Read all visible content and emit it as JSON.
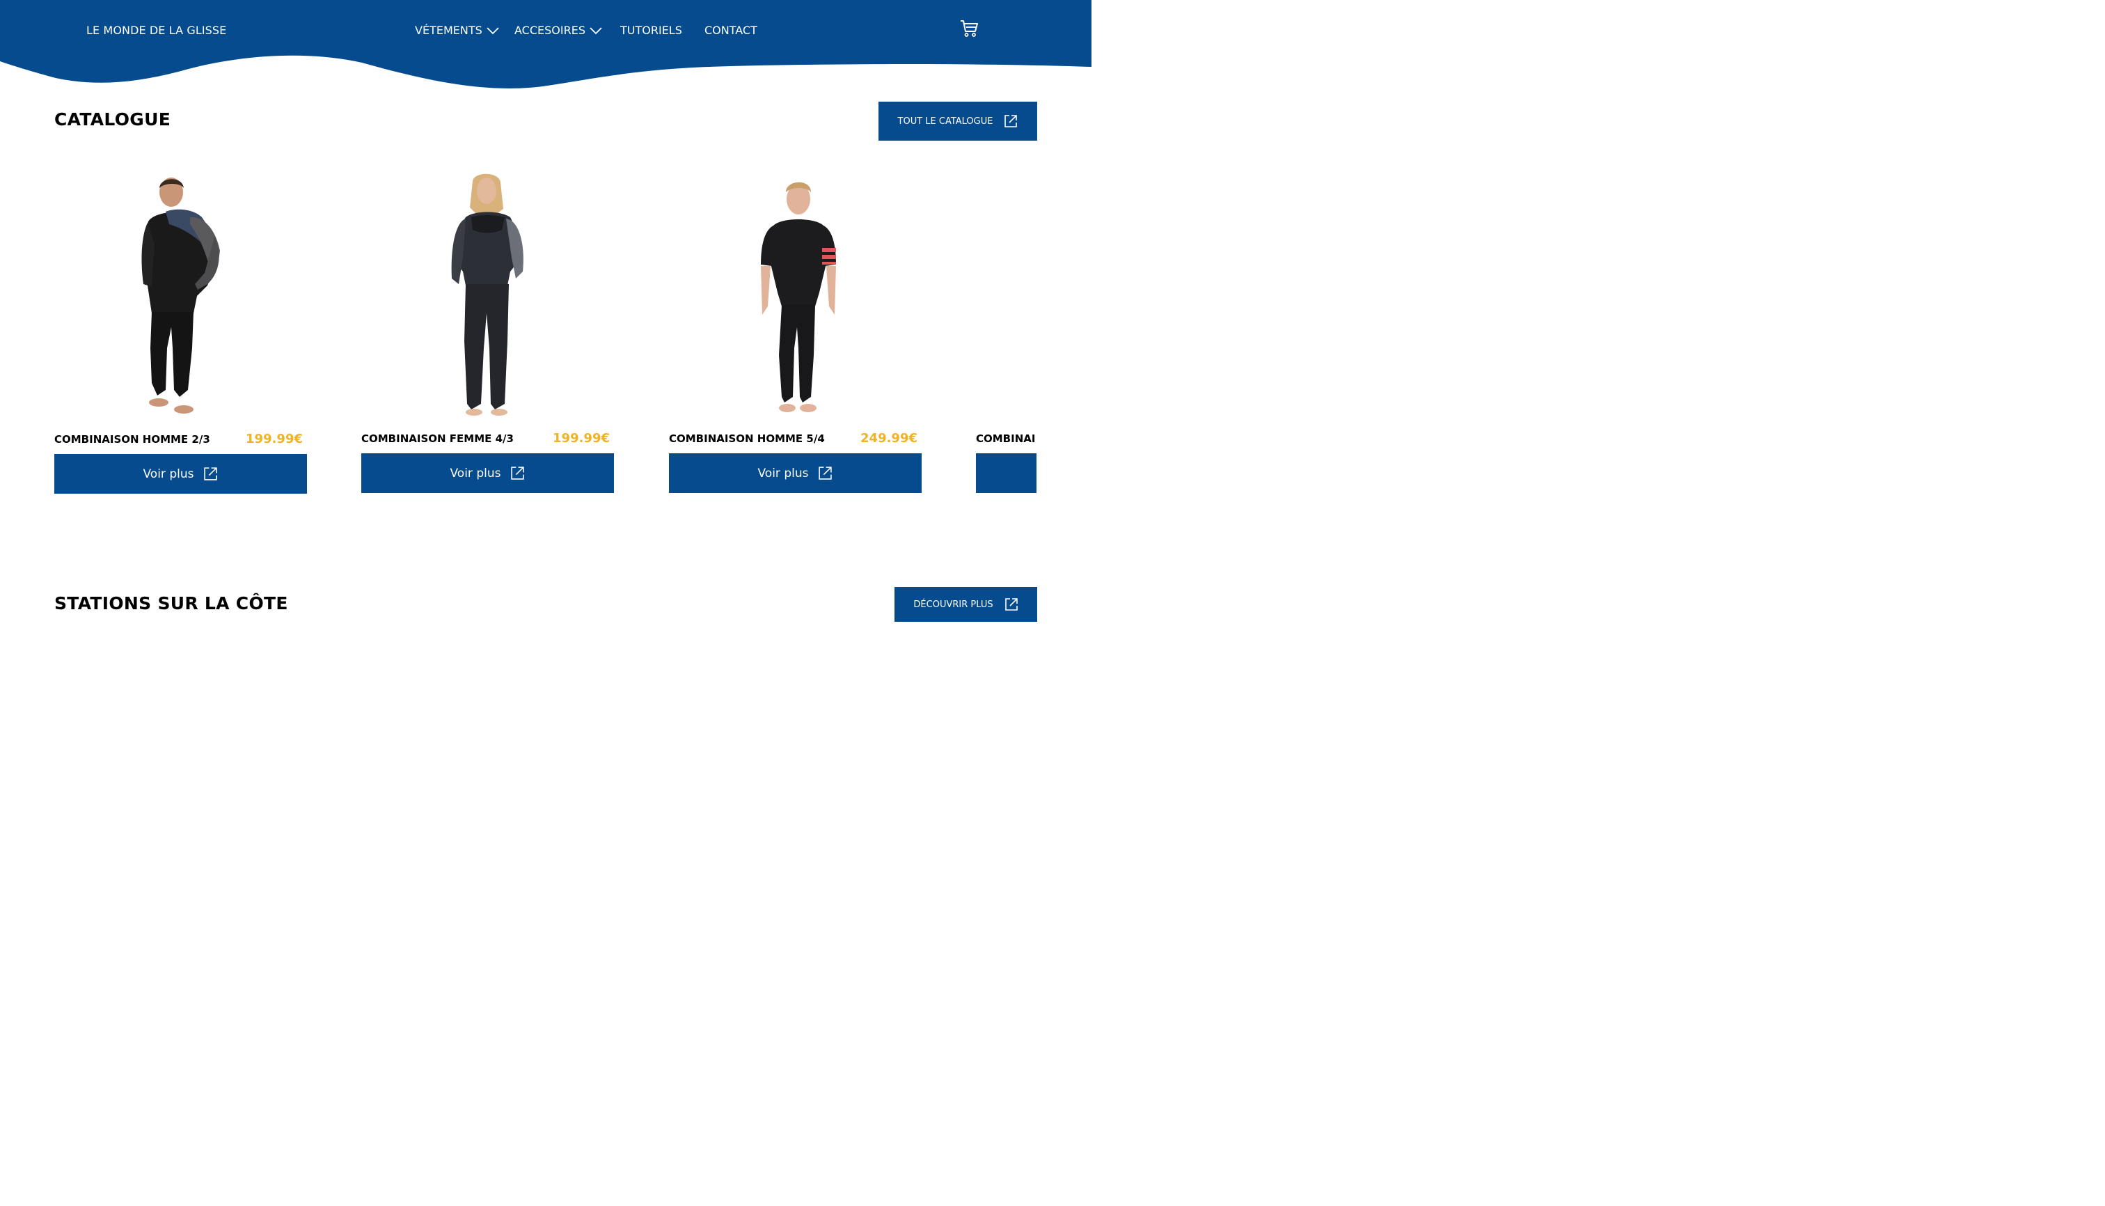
{
  "header": {
    "brand": "LE MONDE DE LA GLISSE",
    "nav": [
      {
        "label": "VÉTEMENTS",
        "has_dropdown": true
      },
      {
        "label": "ACCESOIRES",
        "has_dropdown": true
      },
      {
        "label": "TUTORIELS",
        "has_dropdown": false
      },
      {
        "label": "CONTACT",
        "has_dropdown": false
      }
    ],
    "cart_icon": "cart-icon"
  },
  "catalogue": {
    "title": "CATALOGUE",
    "cta_label": "TOUT LE CATALOGUE",
    "products": [
      {
        "name": "COMBINAISON HOMME 2/3",
        "price": "199.99€",
        "button": "Voir plus"
      },
      {
        "name": "COMBINAISON FEMME 4/3",
        "price": "199.99€",
        "button": "Voir plus"
      },
      {
        "name": "COMBINAISON HOMME 5/4",
        "price": "249.99€",
        "button": "Voir plus"
      },
      {
        "name": "COMBINAI",
        "price": "",
        "button": ""
      }
    ]
  },
  "stations": {
    "title": "STATIONS SUR LA CÔTE",
    "cta_label": "DÉCOUVRIR PLUS"
  },
  "colors": {
    "primary": "#064b8e",
    "price": "#f0b325",
    "background": "#ffffff"
  }
}
